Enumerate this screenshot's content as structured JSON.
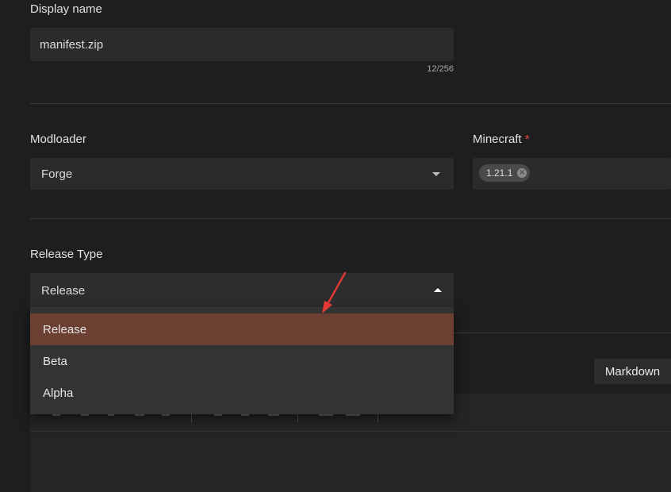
{
  "display_name": {
    "label": "Display name",
    "value": "manifest.zip",
    "counter": "12/256"
  },
  "modloader": {
    "label": "Modloader",
    "value": "Forge"
  },
  "minecraft": {
    "label": "Minecraft",
    "required_mark": "*",
    "chips": [
      "1.21.1"
    ]
  },
  "release_type": {
    "label": "Release Type",
    "value": "Release",
    "options": [
      "Release",
      "Beta",
      "Alpha"
    ],
    "selected_index": 0
  },
  "editor": {
    "markdown_button": "Markdown"
  },
  "colors": {
    "background": "#1e1e1e",
    "field": "#2b2b2b",
    "selected_option": "#6b3f32",
    "required": "#e04a3f",
    "annotation_arrow": "#e53935"
  }
}
